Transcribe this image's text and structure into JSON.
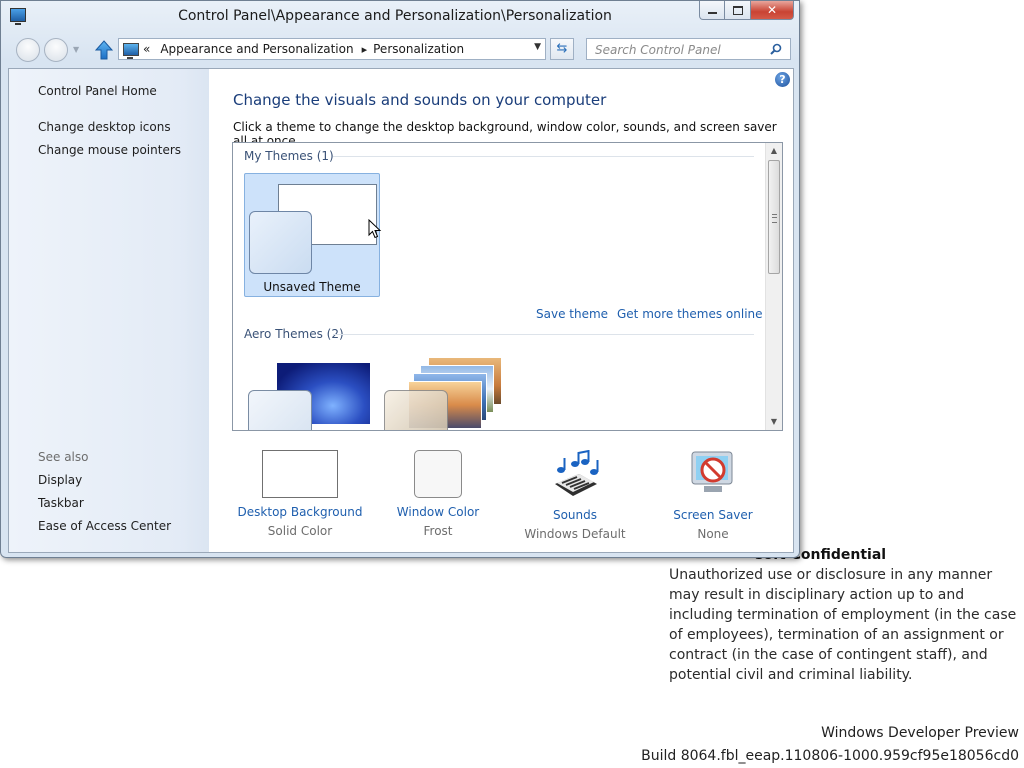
{
  "window": {
    "title": "Control Panel\\Appearance and Personalization\\Personalization"
  },
  "address_bar": {
    "overflow": "«",
    "crumbs": [
      "Appearance and Personalization",
      "Personalization"
    ],
    "separator": "▸"
  },
  "search": {
    "placeholder": "Search Control Panel"
  },
  "left_pane": {
    "links": [
      "Control Panel Home",
      "Change desktop icons",
      "Change mouse pointers"
    ],
    "see_also_label": "See also",
    "see_also": [
      "Display",
      "Taskbar",
      "Ease of Access Center"
    ]
  },
  "main": {
    "heading": "Change the visuals and sounds on your computer",
    "subheading": "Click a theme to change the desktop background, window color, sounds, and screen saver all at once.",
    "groups": [
      {
        "label": "My Themes (1)",
        "themes": [
          "Unsaved Theme"
        ]
      },
      {
        "label": "Aero Themes (2)",
        "themes": []
      }
    ],
    "save_theme_link": "Save theme",
    "more_themes_link": "Get more themes online"
  },
  "bottom_settings": [
    {
      "label": "Desktop Background",
      "value": "Solid Color",
      "icon": "desktop-background-icon"
    },
    {
      "label": "Window Color",
      "value": "Frost",
      "icon": "window-color-icon"
    },
    {
      "label": "Sounds",
      "value": "Windows Default",
      "icon": "sounds-icon"
    },
    {
      "label": "Screen Saver",
      "value": "None",
      "icon": "screen-saver-icon"
    }
  ],
  "desktop": {
    "confidential_title": "soft Confidential",
    "confidential_text": "Unauthorized use or disclosure in any manner may result in disciplinary action up to and including termination of employment (in the case of employees), termination of an assignment or contract (in the case of contingent staff), and potential civil and criminal liability.",
    "watermark_line1": "Windows Developer Preview",
    "watermark_line2": "Build 8064.fbl_eeap.110806-1000.959cf95e18056cd0"
  },
  "colors": {
    "link": "#1f5fae",
    "heading": "#1a3d7a",
    "selected_tile": "#cde2fa",
    "close_button": "#c94333"
  }
}
